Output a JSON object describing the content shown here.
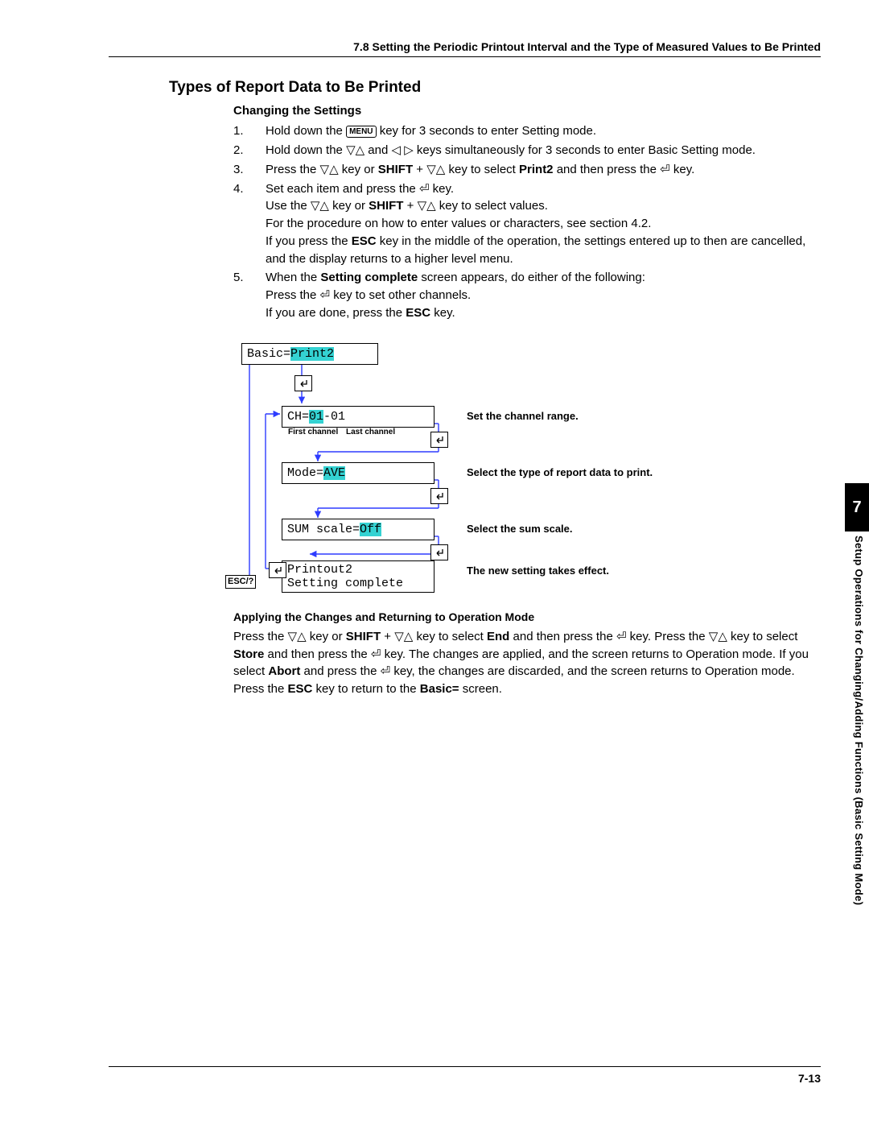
{
  "header": "7.8  Setting the Periodic Printout Interval and the Type of Measured Values to Be Printed",
  "title": "Types of Report Data to Be Printed",
  "changing_heading": "Changing the Settings",
  "steps": [
    {
      "n": "1.",
      "pre": "Hold down the ",
      "post": " key for 3 seconds to enter Setting mode.",
      "menu": "MENU"
    },
    {
      "n": "2.",
      "text": "Hold down the ▽△ and ◁ ▷ keys simultaneously for 3 seconds to enter Basic Setting mode."
    },
    {
      "n": "3.",
      "html": "Press the ▽△ key or <b>SHIFT</b> + ▽△ key to select <b>Print2</b> and then press the ⏎ key."
    },
    {
      "n": "4.",
      "html": "Set each item and press the ⏎ key.<br>Use the ▽△ key or <b>SHIFT</b> + ▽△ key to select values.<br>For the procedure on how to enter values or characters, see section 4.2.<br>If you press the <b>ESC</b> key in the middle of the operation, the settings entered up to then are cancelled, and the display returns to a higher level menu."
    },
    {
      "n": "5.",
      "html": "When the <b>Setting complete</b> screen appears, do either of the following:<br>Press the ⏎ key to set other channels.<br>If you are done, press the <b>ESC</b> key."
    }
  ],
  "diagram": {
    "box1_pre": "Basic=",
    "box1_hl": "Print2",
    "box2_pre": "CH=",
    "box2_hl": "01",
    "box2_post": "-01",
    "box2_fc": "First channel",
    "box2_lc": "Last channel",
    "box3_pre": "Mode=",
    "box3_hl": "AVE",
    "box4_pre": "SUM scale=",
    "box4_hl": "Off",
    "box5_l1": "Printout2",
    "box5_l2": "Setting complete",
    "lab2": "Set the channel range.",
    "lab3": "Select the type of report data to print.",
    "lab4": "Select the sum scale.",
    "lab5": "The new setting takes effect.",
    "esc": "ESC/?"
  },
  "apply_heading": "Applying the Changes and Returning to Operation Mode",
  "apply_body": "Press the ▽△ key or <b>SHIFT</b> + ▽△ key to select <b>End</b> and then press the ⏎ key.  Press the ▽△ key to select <b>Store</b> and then press the ⏎ key.  The changes are applied, and the screen returns to Operation mode.  If you select <b>Abort</b> and press the ⏎ key, the changes are discarded, and the screen returns to Operation mode.  Press the <b>ESC</b> key to return to the <b>Basic=</b> screen.",
  "side_num": "7",
  "side_text": "Setup Operations for Changing/Adding Functions (Basic Setting Mode)",
  "page_num": "7-13"
}
